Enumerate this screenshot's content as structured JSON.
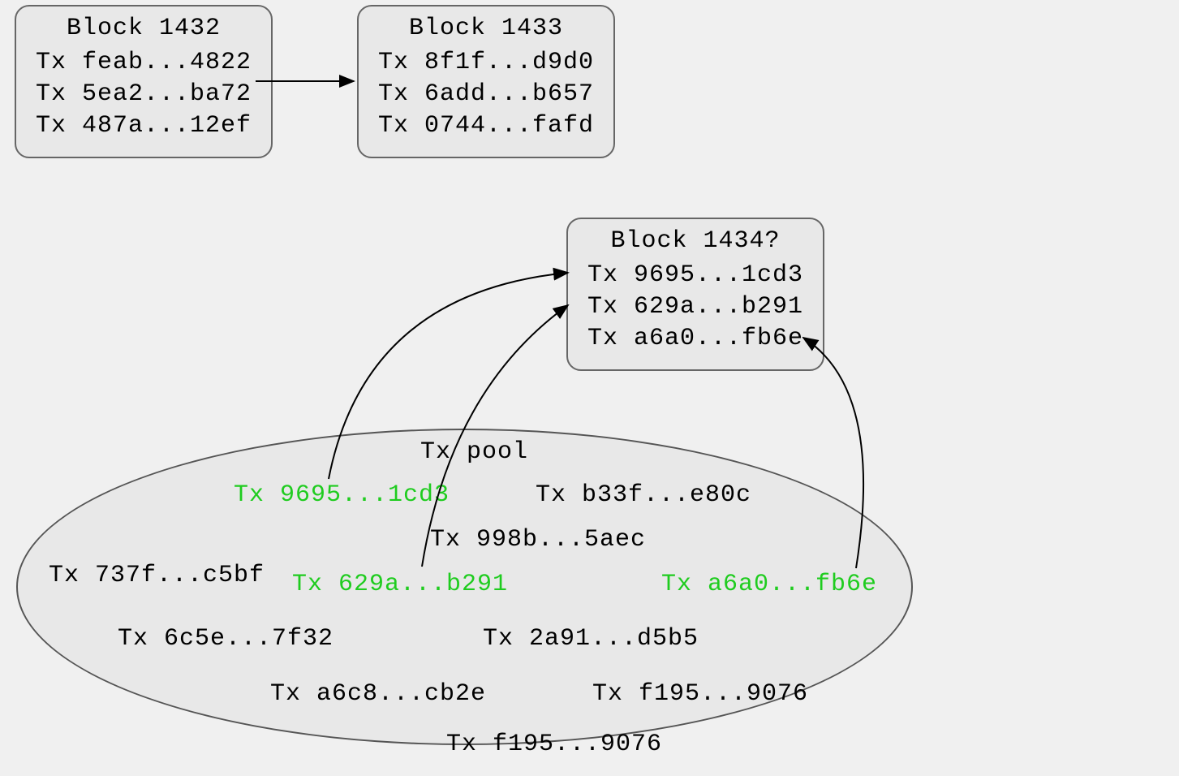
{
  "block1": {
    "title": "Block 1432",
    "tx": [
      "Tx feab...4822",
      "Tx 5ea2...ba72",
      "Tx 487a...12ef"
    ]
  },
  "block2": {
    "title": "Block 1433",
    "tx": [
      "Tx 8f1f...d9d0",
      "Tx 6add...b657",
      "Tx 0744...fafd"
    ]
  },
  "block3": {
    "title": "Block 1434?",
    "tx": [
      "Tx 9695...1cd3",
      "Tx 629a...b291",
      "Tx a6a0...fb6e"
    ]
  },
  "pool": {
    "label": "Tx pool",
    "items": {
      "p0": "Tx 9695...1cd3",
      "p1": "Tx b33f...e80c",
      "p2": "Tx 998b...5aec",
      "p3": "Tx 737f...c5bf",
      "p4": "Tx 629a...b291",
      "p5": "Tx a6a0...fb6e",
      "p6": "Tx 6c5e...7f32",
      "p7": "Tx 2a91...d5b5",
      "p8": "Tx a6c8...cb2e",
      "p9": "Tx f195...9076",
      "p10": "Tx f195...9076"
    }
  }
}
